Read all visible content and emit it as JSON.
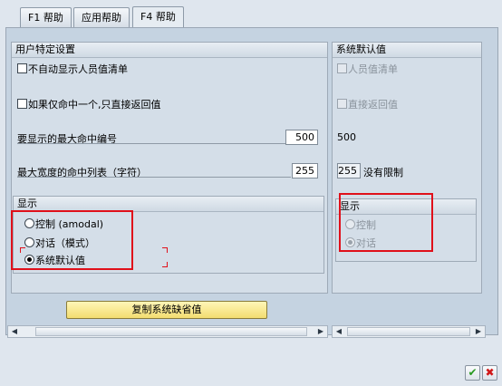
{
  "tabs": [
    {
      "label": "F1 帮助",
      "active": false
    },
    {
      "label": "应用帮助",
      "active": false
    },
    {
      "label": "F4 帮助",
      "active": true
    }
  ],
  "user_group": {
    "title": "用户特定设置",
    "checkbox1": "不自动显示人员值清单",
    "checkbox2": "如果仅命中一个,只直接返回值",
    "max_hits_label": "要显示的最大命中编号",
    "max_hits_value": "500",
    "max_width_label": "最大宽度的命中列表（字符）",
    "max_width_value": "255",
    "display": {
      "title": "显示",
      "options": [
        {
          "label": "控制 (amodal)",
          "selected": false
        },
        {
          "label": "对话（模式）",
          "selected": false
        },
        {
          "label": "系统默认值",
          "selected": true
        }
      ]
    }
  },
  "system_group": {
    "title": "系统默认值",
    "checkbox1": "人员值清单",
    "checkbox2": "直接返回值",
    "max_hits_value": "500",
    "max_width_value": "255",
    "unlimited_label": "没有限制",
    "display": {
      "title": "显示",
      "options": [
        {
          "label": "控制",
          "selected": false
        },
        {
          "label": "对话",
          "selected": true
        }
      ]
    }
  },
  "copy_button": "复制系统缺省值",
  "colors": {
    "annotation_red": "#e0101a",
    "button_yellow": "#f3dd70",
    "panel_blue": "#c5d3e1"
  },
  "icons": [
    "scroll-left-icon",
    "scroll-right-icon",
    "checkmark-icon",
    "close-icon"
  ]
}
